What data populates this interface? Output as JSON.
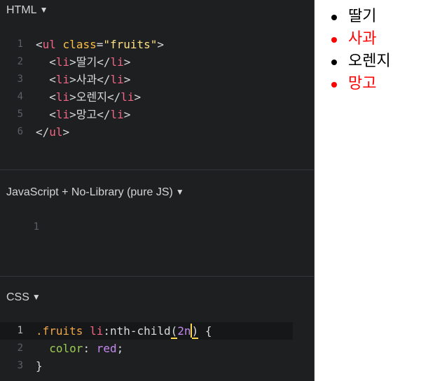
{
  "html_panel": {
    "title": "HTML",
    "lines": [
      {
        "num": "1",
        "tokens": [
          [
            "t-punc",
            "<"
          ],
          [
            "t-tag",
            "ul"
          ],
          [
            "t-punc",
            " "
          ],
          [
            "t-attr",
            "class"
          ],
          [
            "t-punc",
            "="
          ],
          [
            "t-str",
            "\"fruits\""
          ],
          [
            "t-punc",
            ">"
          ]
        ]
      },
      {
        "num": "2",
        "tokens": [
          [
            "t-punc",
            "  <"
          ],
          [
            "t-tag",
            "li"
          ],
          [
            "t-punc",
            ">딸기</"
          ],
          [
            "t-tag",
            "li"
          ],
          [
            "t-punc",
            ">"
          ]
        ]
      },
      {
        "num": "3",
        "tokens": [
          [
            "t-punc",
            "  <"
          ],
          [
            "t-tag",
            "li"
          ],
          [
            "t-punc",
            ">사과</"
          ],
          [
            "t-tag",
            "li"
          ],
          [
            "t-punc",
            ">"
          ]
        ]
      },
      {
        "num": "4",
        "tokens": [
          [
            "t-punc",
            "  <"
          ],
          [
            "t-tag",
            "li"
          ],
          [
            "t-punc",
            ">오렌지</"
          ],
          [
            "t-tag",
            "li"
          ],
          [
            "t-punc",
            ">"
          ]
        ]
      },
      {
        "num": "5",
        "tokens": [
          [
            "t-punc",
            "  <"
          ],
          [
            "t-tag",
            "li"
          ],
          [
            "t-punc",
            ">망고</"
          ],
          [
            "t-tag",
            "li"
          ],
          [
            "t-punc",
            ">"
          ]
        ]
      },
      {
        "num": "6",
        "tokens": [
          [
            "t-punc",
            "</"
          ],
          [
            "t-tag",
            "ul"
          ],
          [
            "t-punc",
            ">"
          ]
        ]
      }
    ]
  },
  "js_panel": {
    "title": "JavaScript + No-Library (pure JS)",
    "lines": [
      {
        "num": "1",
        "tokens": []
      }
    ]
  },
  "css_panel": {
    "title": "CSS",
    "lines": [
      {
        "num": "1",
        "active": true,
        "tokens": [
          [
            "t-sel",
            ".fruits "
          ],
          [
            "t-tag",
            "li"
          ],
          [
            "t-punc",
            ":nth-child"
          ],
          [
            "t-punc matchbracket",
            "("
          ],
          [
            "t-num",
            "2n"
          ],
          [
            "cursor",
            ""
          ],
          [
            "t-punc matchbracket",
            ")"
          ],
          [
            "t-punc",
            " {"
          ]
        ]
      },
      {
        "num": "2",
        "tokens": [
          [
            "t-punc",
            "  "
          ],
          [
            "t-prop",
            "color"
          ],
          [
            "t-punc",
            ": "
          ],
          [
            "t-val",
            "red"
          ],
          [
            "t-punc",
            ";"
          ]
        ]
      },
      {
        "num": "3",
        "tokens": [
          [
            "t-punc",
            "}"
          ]
        ]
      }
    ]
  },
  "preview": {
    "items": [
      "딸기",
      "사과",
      "오렌지",
      "망고"
    ],
    "even_color": "#ff0000",
    "default_color": "#000000"
  },
  "icons": {
    "collapse": "caret-down-icon"
  },
  "caret_glyph": "▼"
}
